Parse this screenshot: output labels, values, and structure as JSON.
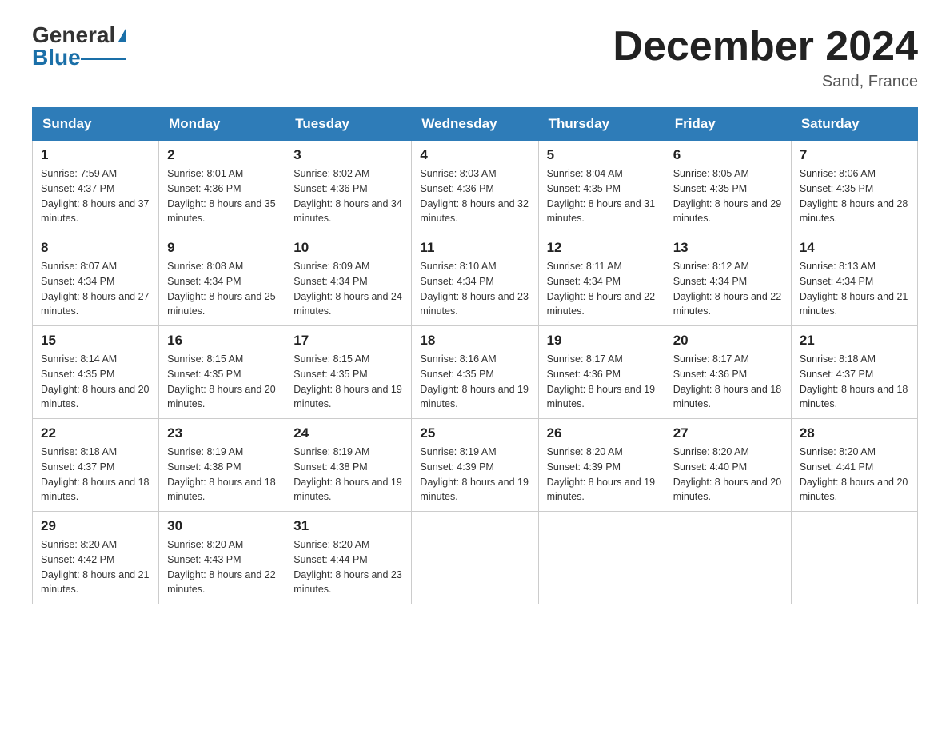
{
  "header": {
    "logo_general": "General",
    "logo_blue": "Blue",
    "month_title": "December 2024",
    "location": "Sand, France"
  },
  "weekdays": [
    "Sunday",
    "Monday",
    "Tuesday",
    "Wednesday",
    "Thursday",
    "Friday",
    "Saturday"
  ],
  "weeks": [
    [
      {
        "day": "1",
        "sunrise": "7:59 AM",
        "sunset": "4:37 PM",
        "daylight": "8 hours and 37 minutes."
      },
      {
        "day": "2",
        "sunrise": "8:01 AM",
        "sunset": "4:36 PM",
        "daylight": "8 hours and 35 minutes."
      },
      {
        "day": "3",
        "sunrise": "8:02 AM",
        "sunset": "4:36 PM",
        "daylight": "8 hours and 34 minutes."
      },
      {
        "day": "4",
        "sunrise": "8:03 AM",
        "sunset": "4:36 PM",
        "daylight": "8 hours and 32 minutes."
      },
      {
        "day": "5",
        "sunrise": "8:04 AM",
        "sunset": "4:35 PM",
        "daylight": "8 hours and 31 minutes."
      },
      {
        "day": "6",
        "sunrise": "8:05 AM",
        "sunset": "4:35 PM",
        "daylight": "8 hours and 29 minutes."
      },
      {
        "day": "7",
        "sunrise": "8:06 AM",
        "sunset": "4:35 PM",
        "daylight": "8 hours and 28 minutes."
      }
    ],
    [
      {
        "day": "8",
        "sunrise": "8:07 AM",
        "sunset": "4:34 PM",
        "daylight": "8 hours and 27 minutes."
      },
      {
        "day": "9",
        "sunrise": "8:08 AM",
        "sunset": "4:34 PM",
        "daylight": "8 hours and 25 minutes."
      },
      {
        "day": "10",
        "sunrise": "8:09 AM",
        "sunset": "4:34 PM",
        "daylight": "8 hours and 24 minutes."
      },
      {
        "day": "11",
        "sunrise": "8:10 AM",
        "sunset": "4:34 PM",
        "daylight": "8 hours and 23 minutes."
      },
      {
        "day": "12",
        "sunrise": "8:11 AM",
        "sunset": "4:34 PM",
        "daylight": "8 hours and 22 minutes."
      },
      {
        "day": "13",
        "sunrise": "8:12 AM",
        "sunset": "4:34 PM",
        "daylight": "8 hours and 22 minutes."
      },
      {
        "day": "14",
        "sunrise": "8:13 AM",
        "sunset": "4:34 PM",
        "daylight": "8 hours and 21 minutes."
      }
    ],
    [
      {
        "day": "15",
        "sunrise": "8:14 AM",
        "sunset": "4:35 PM",
        "daylight": "8 hours and 20 minutes."
      },
      {
        "day": "16",
        "sunrise": "8:15 AM",
        "sunset": "4:35 PM",
        "daylight": "8 hours and 20 minutes."
      },
      {
        "day": "17",
        "sunrise": "8:15 AM",
        "sunset": "4:35 PM",
        "daylight": "8 hours and 19 minutes."
      },
      {
        "day": "18",
        "sunrise": "8:16 AM",
        "sunset": "4:35 PM",
        "daylight": "8 hours and 19 minutes."
      },
      {
        "day": "19",
        "sunrise": "8:17 AM",
        "sunset": "4:36 PM",
        "daylight": "8 hours and 19 minutes."
      },
      {
        "day": "20",
        "sunrise": "8:17 AM",
        "sunset": "4:36 PM",
        "daylight": "8 hours and 18 minutes."
      },
      {
        "day": "21",
        "sunrise": "8:18 AM",
        "sunset": "4:37 PM",
        "daylight": "8 hours and 18 minutes."
      }
    ],
    [
      {
        "day": "22",
        "sunrise": "8:18 AM",
        "sunset": "4:37 PM",
        "daylight": "8 hours and 18 minutes."
      },
      {
        "day": "23",
        "sunrise": "8:19 AM",
        "sunset": "4:38 PM",
        "daylight": "8 hours and 18 minutes."
      },
      {
        "day": "24",
        "sunrise": "8:19 AM",
        "sunset": "4:38 PM",
        "daylight": "8 hours and 19 minutes."
      },
      {
        "day": "25",
        "sunrise": "8:19 AM",
        "sunset": "4:39 PM",
        "daylight": "8 hours and 19 minutes."
      },
      {
        "day": "26",
        "sunrise": "8:20 AM",
        "sunset": "4:39 PM",
        "daylight": "8 hours and 19 minutes."
      },
      {
        "day": "27",
        "sunrise": "8:20 AM",
        "sunset": "4:40 PM",
        "daylight": "8 hours and 20 minutes."
      },
      {
        "day": "28",
        "sunrise": "8:20 AM",
        "sunset": "4:41 PM",
        "daylight": "8 hours and 20 minutes."
      }
    ],
    [
      {
        "day": "29",
        "sunrise": "8:20 AM",
        "sunset": "4:42 PM",
        "daylight": "8 hours and 21 minutes."
      },
      {
        "day": "30",
        "sunrise": "8:20 AM",
        "sunset": "4:43 PM",
        "daylight": "8 hours and 22 minutes."
      },
      {
        "day": "31",
        "sunrise": "8:20 AM",
        "sunset": "4:44 PM",
        "daylight": "8 hours and 23 minutes."
      },
      {
        "day": "",
        "sunrise": "",
        "sunset": "",
        "daylight": ""
      },
      {
        "day": "",
        "sunrise": "",
        "sunset": "",
        "daylight": ""
      },
      {
        "day": "",
        "sunrise": "",
        "sunset": "",
        "daylight": ""
      },
      {
        "day": "",
        "sunrise": "",
        "sunset": "",
        "daylight": ""
      }
    ]
  ],
  "labels": {
    "sunrise": "Sunrise: ",
    "sunset": "Sunset: ",
    "daylight": "Daylight: "
  }
}
